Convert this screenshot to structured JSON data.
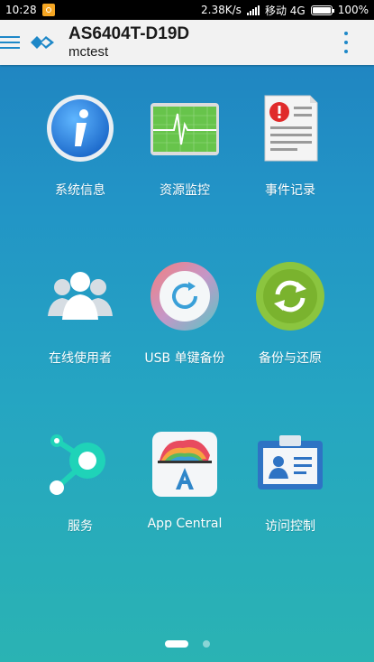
{
  "status_bar": {
    "time": "10:28",
    "network_speed": "2.38K/s",
    "carrier": "移动 4G",
    "battery": "100%",
    "icons": [
      "notification-icon",
      "signal-icon",
      "battery-icon"
    ]
  },
  "app_bar": {
    "title": "AS6404T-D19D",
    "subtitle": "mctest",
    "icons": [
      "menu-icon",
      "asustor-logo",
      "overflow-menu-icon"
    ],
    "accent_color": "#1e88c8"
  },
  "tiles": [
    {
      "label": "系统信息",
      "icon": "info-icon"
    },
    {
      "label": "资源监控",
      "icon": "monitor-icon"
    },
    {
      "label": "事件记录",
      "icon": "event-log-icon"
    },
    {
      "label": "在线使用者",
      "icon": "online-users-icon"
    },
    {
      "label": "USB 单键备份",
      "icon": "usb-backup-icon"
    },
    {
      "label": "备份与还原",
      "icon": "backup-restore-icon"
    },
    {
      "label": "服务",
      "icon": "services-icon"
    },
    {
      "label": "App Central",
      "icon": "app-central-icon"
    },
    {
      "label": "访问控制",
      "icon": "access-control-icon"
    }
  ],
  "pager": {
    "pages": 2,
    "current": 1
  }
}
